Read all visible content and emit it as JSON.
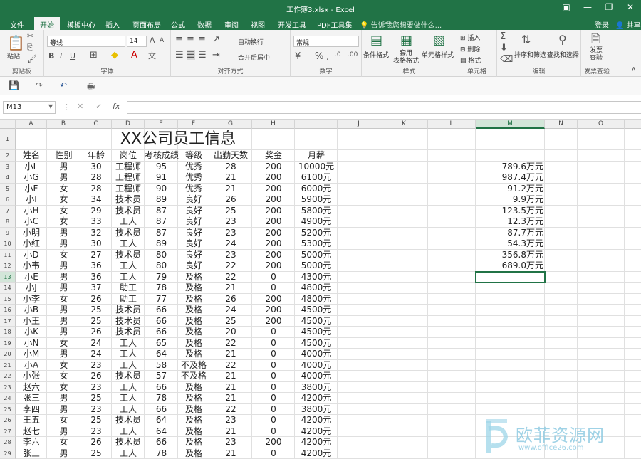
{
  "window": {
    "title": "工作簿3.xlsx - Excel",
    "login": "登录",
    "share": "共享"
  },
  "tabs": [
    "文件",
    "开始",
    "模板中心",
    "插入",
    "页面布局",
    "公式",
    "数据",
    "审阅",
    "视图",
    "开发工具",
    "PDF工具集"
  ],
  "tab_search": "告诉我您想要做什么...",
  "ribbon": {
    "paste": "粘贴",
    "clipboard": "剪贴板",
    "font_name": "等线",
    "font_size": "14",
    "font_group": "字体",
    "wrap": "自动换行",
    "merge": "合并后居中",
    "align_group": "对齐方式",
    "number_format": "常规",
    "number_group": "数字",
    "cond_format": "条件格式",
    "table_format": "套用\n表格格式",
    "cell_style": "单元格样式",
    "style_group": "样式",
    "insert": "插入",
    "delete": "删除",
    "format": "格式",
    "cells_group": "单元格",
    "sort_filter": "排序和筛选",
    "find_select": "查找和选择",
    "edit_group": "编辑",
    "invoice": "发票\n查验",
    "invoice_group": "发票查验"
  },
  "namebox": "M13",
  "columns": [
    "A",
    "B",
    "C",
    "D",
    "E",
    "F",
    "G",
    "H",
    "I",
    "J",
    "K",
    "L",
    "M",
    "N",
    "O"
  ],
  "sheet_title": "XX公司员工信息",
  "headers": [
    "姓名",
    "性别",
    "年龄",
    "岗位",
    "考核成绩",
    "等级",
    "出勤天数",
    "奖金",
    "月薪"
  ],
  "rows": [
    [
      "小L",
      "男",
      "30",
      "工程师",
      "95",
      "优秀",
      "28",
      "200",
      "10000元"
    ],
    [
      "小G",
      "男",
      "28",
      "工程师",
      "91",
      "优秀",
      "21",
      "200",
      "6100元"
    ],
    [
      "小F",
      "女",
      "28",
      "工程师",
      "90",
      "优秀",
      "21",
      "200",
      "6000元"
    ],
    [
      "小I",
      "女",
      "34",
      "技术员",
      "89",
      "良好",
      "26",
      "200",
      "5900元"
    ],
    [
      "小H",
      "女",
      "29",
      "技术员",
      "87",
      "良好",
      "25",
      "200",
      "5800元"
    ],
    [
      "小C",
      "女",
      "33",
      "工人",
      "87",
      "良好",
      "23",
      "200",
      "4900元"
    ],
    [
      "小明",
      "男",
      "32",
      "技术员",
      "87",
      "良好",
      "23",
      "200",
      "5200元"
    ],
    [
      "小红",
      "男",
      "30",
      "工人",
      "89",
      "良好",
      "24",
      "200",
      "5300元"
    ],
    [
      "小D",
      "女",
      "27",
      "技术员",
      "80",
      "良好",
      "23",
      "200",
      "5000元"
    ],
    [
      "小韦",
      "男",
      "36",
      "工人",
      "80",
      "良好",
      "22",
      "200",
      "5000元"
    ],
    [
      "小E",
      "男",
      "36",
      "工人",
      "79",
      "及格",
      "22",
      "0",
      "4300元"
    ],
    [
      "小J",
      "男",
      "37",
      "助工",
      "78",
      "及格",
      "21",
      "0",
      "4800元"
    ],
    [
      "小李",
      "女",
      "26",
      "助工",
      "77",
      "及格",
      "26",
      "200",
      "4800元"
    ],
    [
      "小B",
      "男",
      "25",
      "技术员",
      "66",
      "及格",
      "24",
      "200",
      "4500元"
    ],
    [
      "小王",
      "男",
      "25",
      "技术员",
      "66",
      "及格",
      "25",
      "200",
      "4500元"
    ],
    [
      "小K",
      "男",
      "26",
      "技术员",
      "66",
      "及格",
      "20",
      "0",
      "4500元"
    ],
    [
      "小N",
      "女",
      "24",
      "工人",
      "65",
      "及格",
      "22",
      "0",
      "4500元"
    ],
    [
      "小M",
      "男",
      "24",
      "工人",
      "64",
      "及格",
      "21",
      "0",
      "4000元"
    ],
    [
      "小A",
      "女",
      "23",
      "工人",
      "58",
      "不及格",
      "22",
      "0",
      "4000元"
    ],
    [
      "小张",
      "女",
      "26",
      "技术员",
      "57",
      "不及格",
      "21",
      "0",
      "4000元"
    ],
    [
      "赵六",
      "女",
      "23",
      "工人",
      "66",
      "及格",
      "21",
      "0",
      "3800元"
    ],
    [
      "张三",
      "男",
      "25",
      "工人",
      "78",
      "及格",
      "21",
      "0",
      "4200元"
    ],
    [
      "李四",
      "男",
      "23",
      "工人",
      "66",
      "及格",
      "22",
      "0",
      "3800元"
    ],
    [
      "王五",
      "女",
      "25",
      "技术员",
      "64",
      "及格",
      "23",
      "0",
      "4200元"
    ],
    [
      "赵七",
      "男",
      "23",
      "工人",
      "64",
      "及格",
      "21",
      "0",
      "4200元"
    ],
    [
      "李六",
      "女",
      "26",
      "技术员",
      "66",
      "及格",
      "23",
      "200",
      "4200元"
    ],
    [
      "张三",
      "男",
      "25",
      "工人",
      "78",
      "及格",
      "21",
      "0",
      "4200元"
    ]
  ],
  "m_values": [
    "789.6万元",
    "987.4万元",
    "91.2万元",
    "9.9万元",
    "123.5万元",
    "12.3万元",
    "87.7万元",
    "54.3万元",
    "356.8万元",
    "689.0万元"
  ],
  "watermark": {
    "name": "欧菲资源网",
    "url": "www.office26.com"
  }
}
